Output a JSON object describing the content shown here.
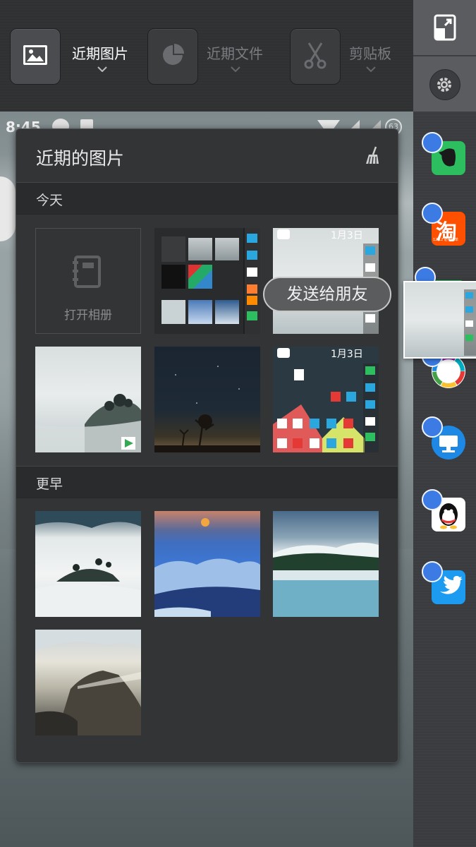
{
  "toolbar": {
    "tabs": [
      {
        "label": "近期图片",
        "icon": "image-icon",
        "active": true
      },
      {
        "label": "近期文件",
        "icon": "pie-chart-icon",
        "active": false
      },
      {
        "label": "剪贴板",
        "icon": "scissors-icon",
        "active": false
      }
    ]
  },
  "statusbar": {
    "time": "8:45",
    "battery": "63"
  },
  "sidebar": {
    "top_icons": [
      "window-resize-icon",
      "gear-icon"
    ],
    "apps": [
      {
        "name": "evernote-icon",
        "color": "#2dbe60"
      },
      {
        "name": "taobao-icon",
        "color": "#ff5000",
        "text": "淘",
        "subtext": "12.12 必买清单"
      },
      {
        "name": "wechat-icon",
        "color": "#2dbe60"
      },
      {
        "name": "photos-icon",
        "color": "#ffffff"
      },
      {
        "name": "remote-desktop-icon",
        "color": "#1e88e5"
      },
      {
        "name": "qq-icon",
        "color": "#ffffff"
      },
      {
        "name": "twitter-icon",
        "color": "#1d9bf0"
      }
    ]
  },
  "panel": {
    "title": "近期的图片",
    "sections": [
      {
        "label": "今天"
      },
      {
        "label": "更早"
      }
    ],
    "open_album_label": "打开相册",
    "screenshot_date": "1月3日"
  },
  "tooltip": {
    "text": "发送给朋友"
  },
  "colors": {
    "accent": "#3b7be3",
    "panel_bg": "#333435",
    "section_bg": "#2a2b2c"
  }
}
